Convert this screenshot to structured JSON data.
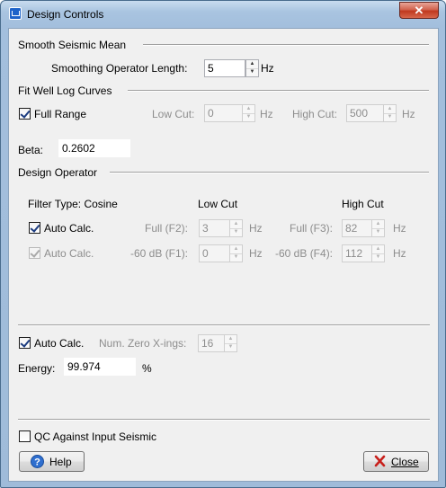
{
  "window": {
    "title": "Design Controls",
    "close_glyph": "✕"
  },
  "smooth": {
    "section_title": "Smooth Seismic Mean",
    "length_label": "Smoothing Operator Length:",
    "length_value": "5",
    "length_unit": "Hz"
  },
  "fitwell": {
    "section_title": "Fit Well Log Curves",
    "full_range_label": "Full Range",
    "low_cut_label": "Low Cut:",
    "low_cut_value": "0",
    "low_cut_unit": "Hz",
    "high_cut_label": "High Cut:",
    "high_cut_value": "500",
    "high_cut_unit": "Hz"
  },
  "beta": {
    "label": "Beta:",
    "value": "0.2602"
  },
  "design": {
    "section_title": "Design Operator",
    "filter_type": "Filter Type: Cosine",
    "low_cut_header": "Low Cut",
    "high_cut_header": "High Cut",
    "row1": {
      "auto_label": "Auto Calc.",
      "low_label": "Full (F2):",
      "low_value": "3",
      "low_unit": "Hz",
      "high_label": "Full (F3):",
      "high_value": "82",
      "high_unit": "Hz"
    },
    "row2": {
      "auto_label": "Auto Calc.",
      "low_label": "-60 dB (F1):",
      "low_value": "0",
      "low_unit": "Hz",
      "high_label": "-60 dB (F4):",
      "high_value": "112",
      "high_unit": "Hz"
    }
  },
  "auto": {
    "auto_label": "Auto Calc.",
    "zero_label": "Num. Zero X-ings:",
    "zero_value": "16",
    "energy_label": "Energy:",
    "energy_value": "99.974",
    "energy_unit": "%"
  },
  "qc": {
    "label": "QC Against Input Seismic"
  },
  "buttons": {
    "help": "Help",
    "close": "Close"
  },
  "colors": {
    "title_bar": "#a9c4e0",
    "close_button": "#c0391f",
    "help_icon": "#2f6fcf",
    "close_icon": "#c8201c"
  },
  "icons": {
    "title": "app-icon",
    "help": "help-icon",
    "close": "close-icon"
  }
}
